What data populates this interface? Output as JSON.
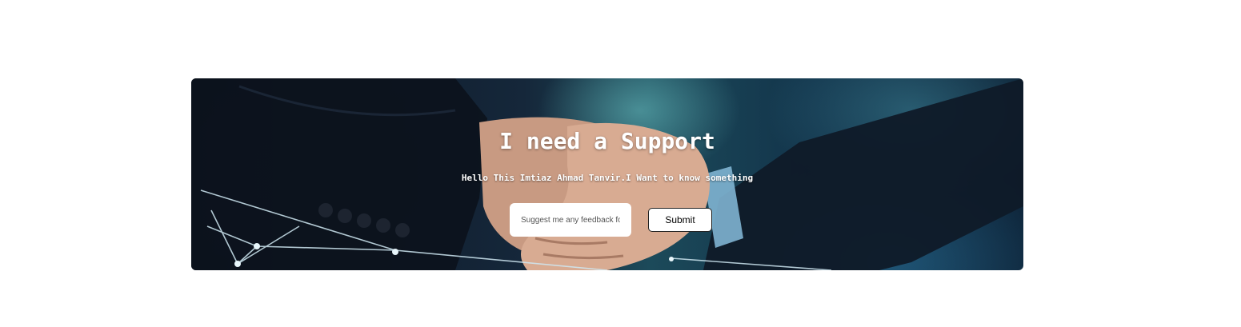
{
  "hero": {
    "title": "I need a Support",
    "subtitle": "Hello This Imtiaz Ahmad Tanvir.I Want to know something"
  },
  "form": {
    "input_placeholder": "Suggest me any feedback fo",
    "input_value": "",
    "submit_label": "Submit"
  },
  "colors": {
    "text": "#ffffff",
    "button_bg": "#ffffff",
    "button_text": "#000000",
    "banner_dark": "#0b1422",
    "banner_teal": "#1c4a5a"
  },
  "background_image": "handshake-photo"
}
